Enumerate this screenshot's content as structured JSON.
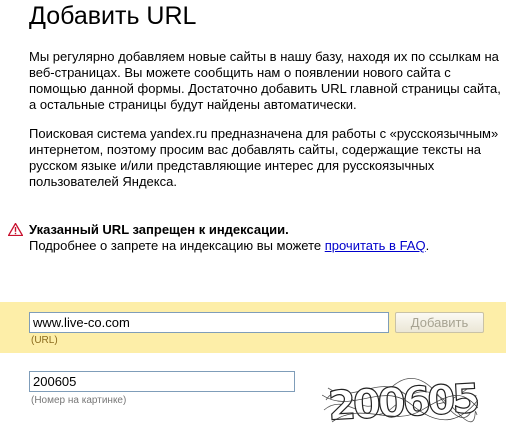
{
  "page": {
    "title": "Добавить URL"
  },
  "intro": {
    "paragraph1": "Мы регулярно добавляем новые сайты в нашу базу, находя их по ссылкам на веб-страницах. Вы можете сообщить нам о появлении нового сайта с помощью данной формы. Достаточно добавить URL главной страницы сайта, а остальные страницы будут найдены автоматически.",
    "paragraph2": "Поисковая система yandex.ru предназначена для работы с «русскоязычным» интернетом, поэтому просим вас добавлять сайты, содержащие тексты на русском языке и/или представляющие интерес для русскоязычных пользователей Яндекса."
  },
  "warning": {
    "icon": "warning-triangle-icon",
    "title": "Указанный URL запрещен к индексации.",
    "text_before_link": "Подробнее о запрете на индексацию вы можете ",
    "link_text": "прочитать в FAQ",
    "text_after_link": "."
  },
  "url_form": {
    "value": "www.live-co.com",
    "label": "(URL)",
    "submit_label": "Добавить",
    "band_color": "#fdeea8"
  },
  "captcha": {
    "value": "200605",
    "label": "(Номер на картинке)",
    "image_text": "200605"
  }
}
